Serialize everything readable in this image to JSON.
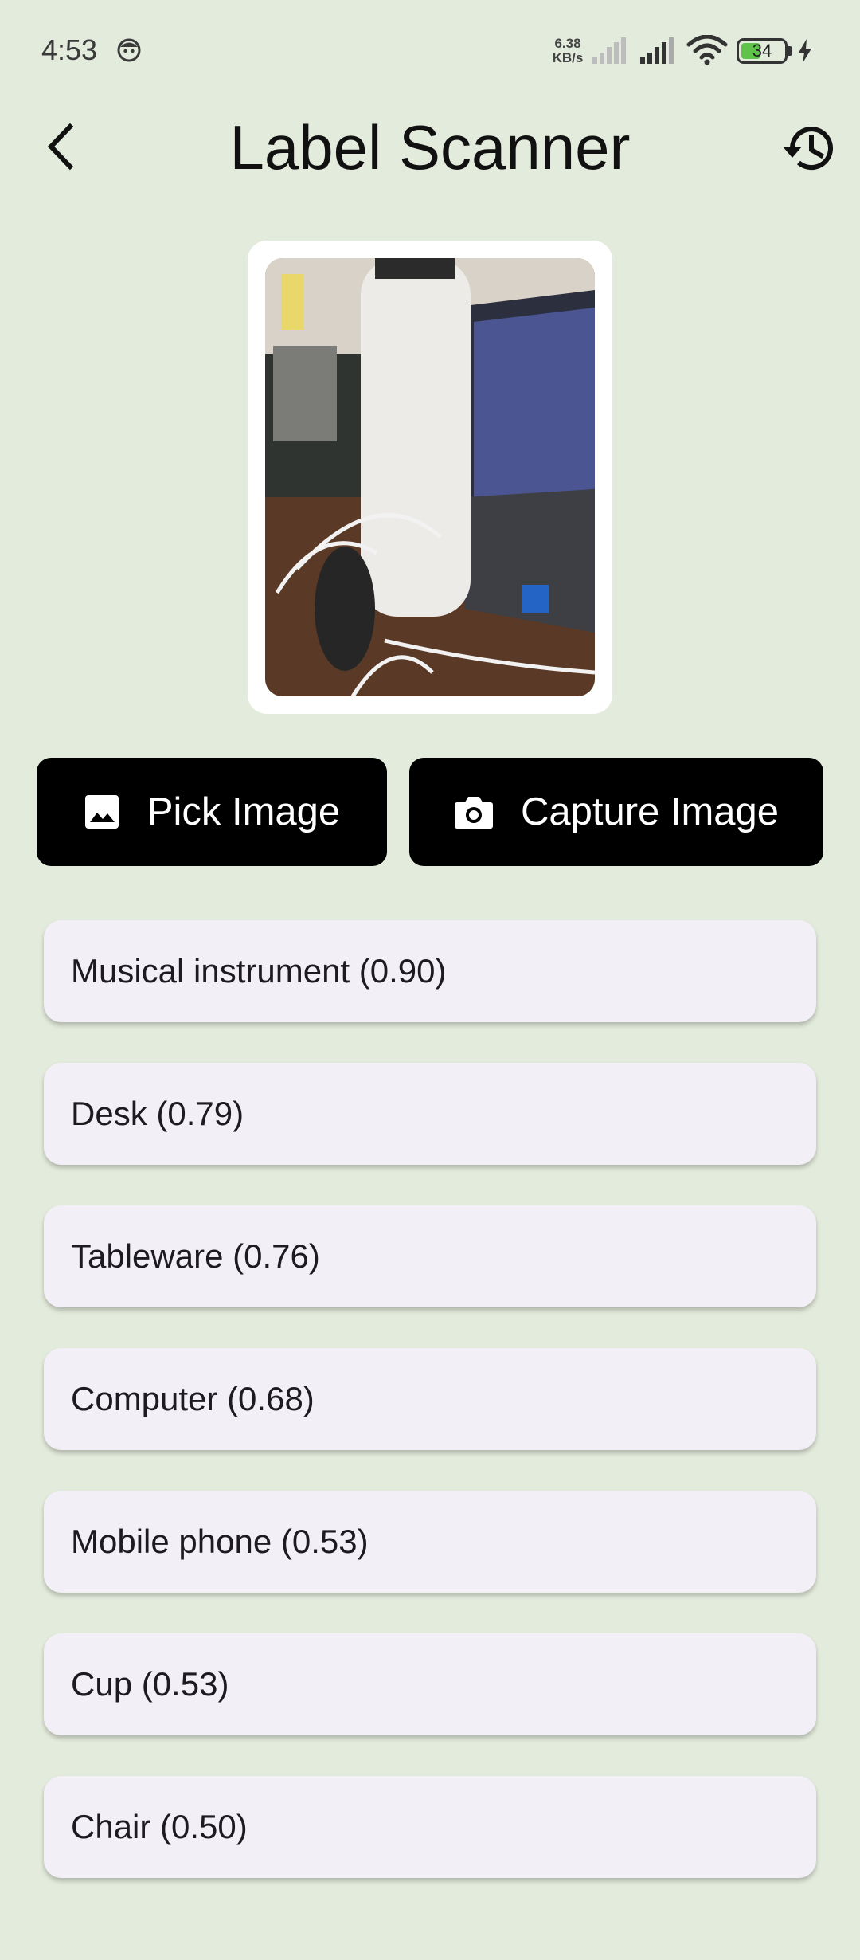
{
  "status_bar": {
    "time": "4:53",
    "net_speed_value": "6.38",
    "net_speed_unit": "KB/s",
    "battery_level": "34"
  },
  "app_bar": {
    "title": "Label Scanner",
    "back_icon": "chevron-left-icon",
    "history_icon": "history-icon"
  },
  "actions": {
    "pick_label": "Pick Image",
    "pick_icon": "image-icon",
    "capture_label": "Capture Image",
    "capture_icon": "camera-icon"
  },
  "results": [
    "Musical instrument (0.90)",
    "Desk (0.79)",
    "Tableware (0.76)",
    "Computer (0.68)",
    "Mobile phone (0.53)",
    "Cup (0.53)",
    "Chair (0.50)"
  ],
  "colors": {
    "background": "#e3ebdc",
    "button": "#000000",
    "card": "#f3eff6",
    "battery_fill": "#5fc24a"
  }
}
